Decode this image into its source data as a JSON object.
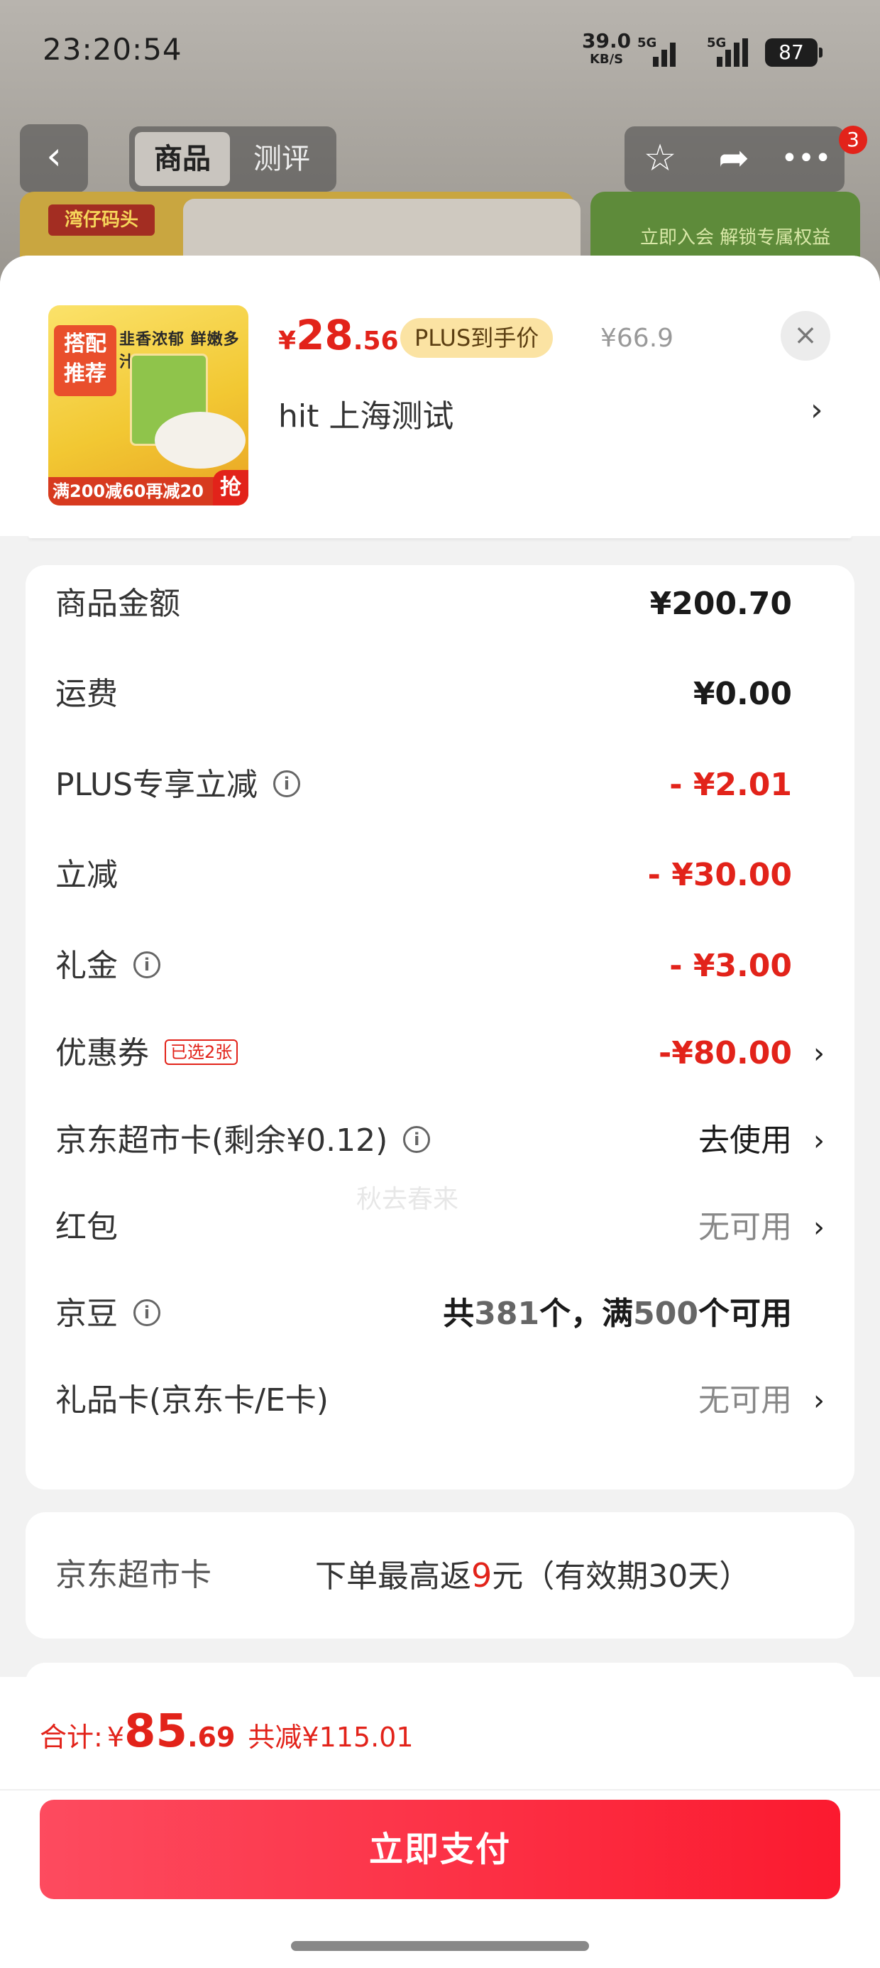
{
  "status_bar": {
    "time": "23:20:54",
    "net_speed": "39.0",
    "net_unit": "KB/S",
    "signal1": "5G",
    "signal2": "5G",
    "battery": "87"
  },
  "nav": {
    "tabs": [
      "商品",
      "测评"
    ],
    "badge_count": "3"
  },
  "background": {
    "brand_logo": "湾仔码头",
    "promo_text": "立即入会 解锁专属权益"
  },
  "product": {
    "image_tag": "搭配推荐",
    "image_slogan": "韭香浓郁 鲜嫩多汁",
    "image_bottom": "满200减60再减20",
    "image_grab": "抢",
    "price_currency": "¥",
    "price_int": "28",
    "price_dec": ".56",
    "plus_label": "PLUS到手价",
    "original_price": "¥66.9",
    "close": "×",
    "address": "hit  上海测试",
    "address_chevron": "›"
  },
  "fees": [
    {
      "label": "商品金额",
      "value": "¥200.70",
      "style": "normal"
    },
    {
      "label": "运费",
      "value": "¥0.00",
      "style": "normal"
    },
    {
      "label": "PLUS专享立减",
      "value": "- ¥2.01",
      "style": "red"
    },
    {
      "label": "立减",
      "value": "- ¥30.00",
      "style": "red"
    },
    {
      "label": "礼金",
      "value": "- ¥3.00",
      "style": "red"
    },
    {
      "label": "优惠券",
      "tag": "已选2张",
      "value": "-¥80.00",
      "style": "red"
    },
    {
      "label": "京东超市卡(剩余¥0.12)",
      "value": "去使用",
      "style": "dark"
    },
    {
      "label": "红包",
      "value": "无可用",
      "style": "grey"
    },
    {
      "label": "京豆",
      "value_prefix": "共",
      "value_count": "381",
      "value_mid": "个，满",
      "value_threshold": "500",
      "value_suffix": "个可用"
    },
    {
      "label": "礼品卡(京东卡/E卡)",
      "value": "无可用",
      "style": "grey"
    }
  ],
  "chevron": "›",
  "info_icon": "i",
  "watermark": "秋去春来",
  "supermarket": {
    "label": "京东超市卡",
    "text_before": "下单最高返",
    "amount": "9",
    "text_after": "元（有效期30天）"
  },
  "footer": {
    "total_label": "合计:",
    "total_currency": "¥",
    "total_int": "85",
    "total_dec": ".69",
    "saved": "共减¥115.01",
    "pay_button": "立即支付"
  },
  "colors": {
    "accent_red": "#e2231a",
    "plus_gold": "#fbe3a3"
  },
  "icons": [
    "back-arrow-icon",
    "star-icon",
    "share-icon",
    "more-icon",
    "close-icon",
    "chevron-right-icon",
    "info-icon"
  ]
}
